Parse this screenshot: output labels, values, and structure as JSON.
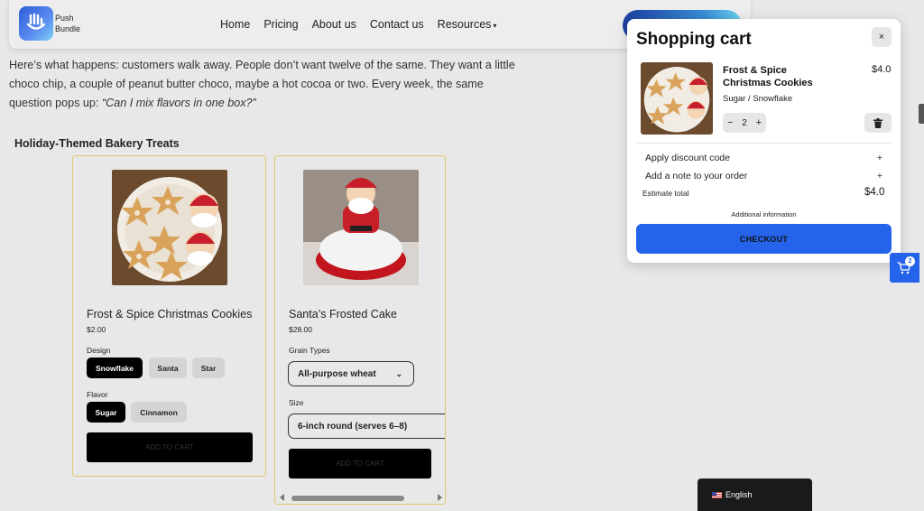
{
  "header": {
    "brand_line1": "Push",
    "brand_line2": "Bundle",
    "nav": [
      "Home",
      "Pricing",
      "About us",
      "Contact us",
      "Resources"
    ]
  },
  "intro": {
    "text": "Here’s what happens: customers walk away. People don’t want twelve of the same. They want a little choco chip, a couple of peanut butter choco, maybe a hot cocoa or two. Every week, the same question pops up: ",
    "quote": "“Can I mix flavors in one box?”"
  },
  "section_title": "Holiday-Themed Bakery Treats",
  "products": [
    {
      "name": "Frost & Spice Christmas Cookies",
      "price": "$2.00",
      "option1_label": "Design",
      "option1_values": [
        "Snowflake",
        "Santa",
        "Star"
      ],
      "option2_label": "Flavor",
      "option2_values": [
        "Sugar",
        "Cinnamon"
      ],
      "button": "ADD TO CART"
    },
    {
      "name": "Santa’s Frosted Cake",
      "price": "$28.00",
      "option1_label": "Grain Types",
      "option1_value": "All-purpose wheat",
      "option2_label": "Size",
      "option2_value": "6-inch round (serves 6–8)",
      "button": "ADD TO CART"
    }
  ],
  "cart": {
    "title": "Shopping cart",
    "close": "×",
    "item_name": "Frost & Spice Christmas Cookies",
    "item_price": "$4.0",
    "item_variant": "Sugar / Snowflake",
    "qty_minus": "−",
    "qty": "2",
    "qty_plus": "+",
    "discount_label": "Apply discount code",
    "note_label": "Add a note to your order",
    "expand_symbol": "+",
    "estimate_label": "Estimate total",
    "estimate_value": "$4.0",
    "additional": "Additional information",
    "checkout": "CHECKOUT"
  },
  "floating_cart_count": "2",
  "language": "English",
  "colors": {
    "accent": "#2563eb",
    "card_border": "#e3c86a"
  }
}
